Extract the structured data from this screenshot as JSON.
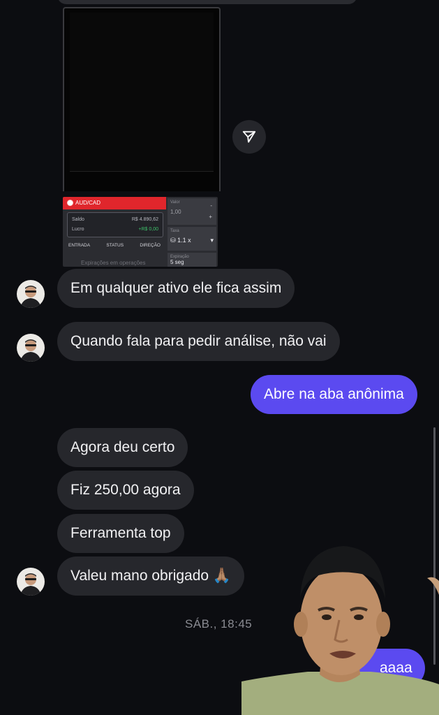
{
  "thread": {
    "messages": [
      {
        "text": "Em qualquer ativo ele fica assim"
      },
      {
        "text": "Quando fala para pedir análise, não vai"
      },
      {
        "text": "Abre na aba anônima"
      },
      {
        "text": "Agora deu certo"
      },
      {
        "text": "Fiz 250,00 agora"
      },
      {
        "text": "Ferramenta top"
      },
      {
        "text": "Valeu mano obrigado 🙏🏽"
      },
      {
        "text": "aaaa"
      }
    ],
    "timestamp": "SÁB., 18:45"
  },
  "attachment": {
    "pair": "AUD/CAD",
    "saldo_label": "Saldo",
    "saldo_value": "R$ 4.890,62",
    "lucro_label": "Lucro",
    "lucro_value": "+R$ 0,00",
    "col_entrada": "ENTRADA",
    "col_status": "STATUS",
    "col_direcao": "DIREÇÃO",
    "footer": "Expirações em operações",
    "valor_label": "Valor",
    "valor_value": "1,00",
    "minus": "-",
    "plus": "+",
    "taxa_label": "Taxa",
    "multiplier": "1.1 x",
    "expiracao_label": "Expiração",
    "expiracao_value": "5 seg"
  },
  "colors": {
    "background": "#0c0d11",
    "bubble_incoming": "#26272c",
    "bubble_outgoing": "#5b4af0",
    "trade_red": "#e0262c",
    "profit_green": "#3ec06a"
  },
  "icons": [
    "share-icon",
    "chevron-down-icon",
    "coins-icon",
    "avatar"
  ]
}
